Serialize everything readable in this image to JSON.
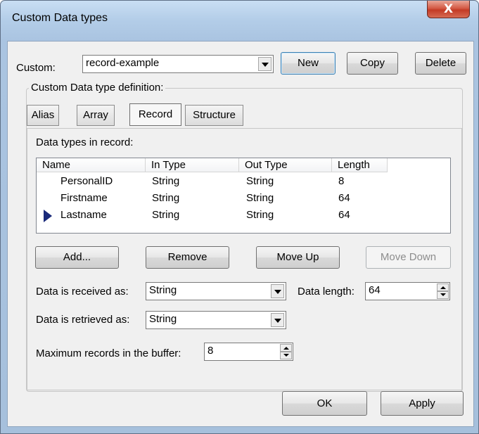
{
  "window": {
    "title": "Custom Data types",
    "close_label": "X"
  },
  "custom": {
    "label": "Custom:",
    "value": "record-example"
  },
  "buttons": {
    "new": "New",
    "copy": "Copy",
    "delete": "Delete",
    "ok": "OK",
    "apply": "Apply"
  },
  "definition": {
    "group_label": "Custom Data type definition:",
    "tabs": [
      {
        "label": "Alias"
      },
      {
        "label": "Array"
      },
      {
        "label": "Record"
      },
      {
        "label": "Structure"
      }
    ],
    "active_tab": "Record"
  },
  "record": {
    "list_label": "Data types in record:",
    "columns": [
      "Name",
      "In Type",
      "Out Type",
      "Length"
    ],
    "rows": [
      {
        "name": "PersonalID",
        "in_type": "String",
        "out_type": "String",
        "length": "8"
      },
      {
        "name": "Firstname",
        "in_type": "String",
        "out_type": "String",
        "length": "64"
      },
      {
        "name": "Lastname",
        "in_type": "String",
        "out_type": "String",
        "length": "64"
      }
    ],
    "current_row": "Lastname",
    "buttons": {
      "add": "Add...",
      "remove": "Remove",
      "move_up": "Move Up",
      "move_down": "Move Down"
    }
  },
  "received": {
    "label": "Data is received as:",
    "value": "String"
  },
  "data_length": {
    "label": "Data length:",
    "value": "64"
  },
  "retrieved": {
    "label": "Data is retrieved as:",
    "value": "String"
  },
  "max_records": {
    "label": "Maximum records in the buffer:",
    "value": "8"
  },
  "colors": {
    "row_marker": "#1a2a7a",
    "close_button": "#c43c28"
  }
}
